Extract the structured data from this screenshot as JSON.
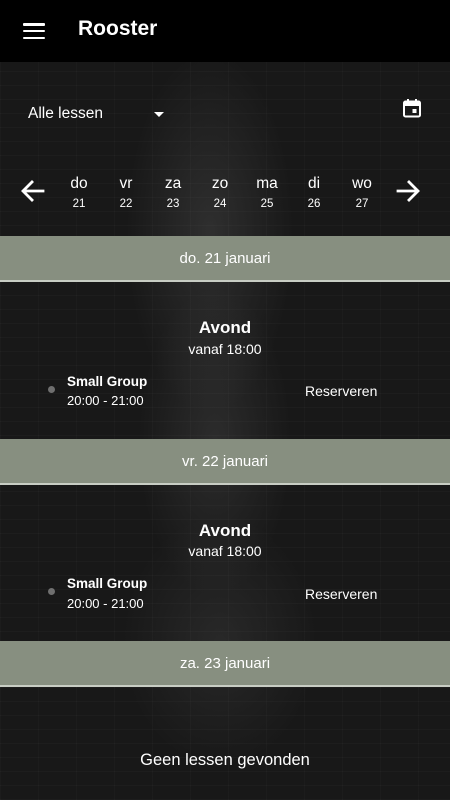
{
  "app": {
    "title": "Rooster",
    "menu_icon": "hamburger-menu-icon"
  },
  "filter": {
    "selected": "Alle lessen",
    "dropdown_icon": "caret-down-icon",
    "calendar_icon": "calendar-icon"
  },
  "week": {
    "prev_icon": "arrow-left-icon",
    "next_icon": "arrow-right-icon",
    "days": [
      {
        "name": "do",
        "num": "21"
      },
      {
        "name": "vr",
        "num": "22"
      },
      {
        "name": "za",
        "num": "23"
      },
      {
        "name": "zo",
        "num": "24"
      },
      {
        "name": "ma",
        "num": "25"
      },
      {
        "name": "di",
        "num": "26"
      },
      {
        "name": "wo",
        "num": "27"
      }
    ]
  },
  "schedule": [
    {
      "date": "do. 21 januari",
      "session": {
        "title": "Avond",
        "subtitle": "vanaf 18:00"
      },
      "class": {
        "name": "Small Group",
        "time": "20:00 - 21:00",
        "action": "Reserveren"
      }
    },
    {
      "date": "vr. 22 januari",
      "session": {
        "title": "Avond",
        "subtitle": "vanaf 18:00"
      },
      "class": {
        "name": "Small Group",
        "time": "20:00 - 21:00",
        "action": "Reserveren"
      }
    },
    {
      "date": "za. 23 januari",
      "empty": "Geen lessen gevonden"
    }
  ],
  "colors": {
    "topbar": "#000000",
    "date_header": "#878f80",
    "background": "#181818"
  }
}
